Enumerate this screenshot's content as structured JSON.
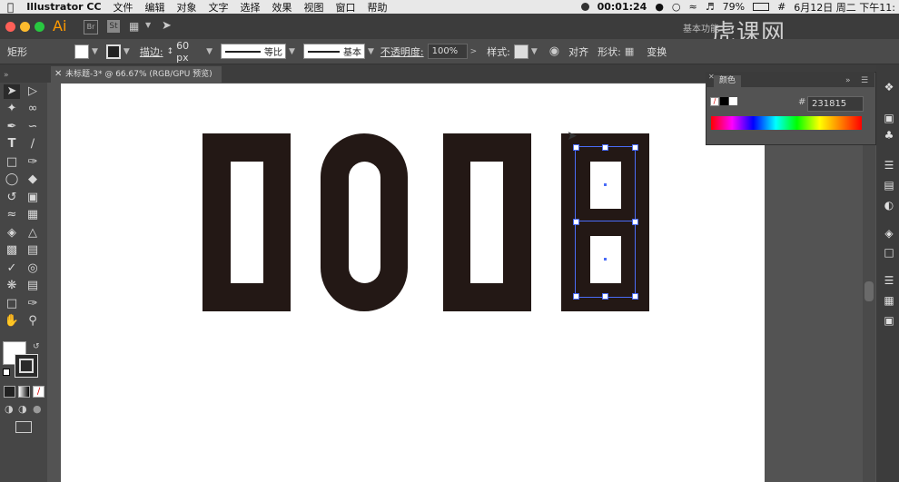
{
  "menubar": {
    "app_name": "Illustrator CC",
    "items": [
      "文件",
      "编辑",
      "对象",
      "文字",
      "选择",
      "效果",
      "视图",
      "窗口",
      "帮助"
    ],
    "timer": "00:01:24",
    "battery": "79%",
    "datetime": "6月12日 周二 下午11:"
  },
  "appbar": {
    "ai_logo": "Ai",
    "st_logo": "St",
    "workspace": "基本功能",
    "watermark": "虎课网"
  },
  "control_bar": {
    "tool_name": "矩形",
    "stroke_label": "描边:",
    "stroke_value": "60 px",
    "profile_label": "等比",
    "brush_label": "基本",
    "opacity_label": "不透明度:",
    "opacity_value": "100%",
    "style_label": "样式:",
    "align_label": "对齐",
    "shape_label": "形状:",
    "transform_label": "变换"
  },
  "document_tab": {
    "title": "未标题-3* @ 66.67% (RGB/GPU 预览)"
  },
  "color_panel": {
    "title": "颜色",
    "hex_label": "#",
    "hex_value": "231815"
  },
  "colors": {
    "fill": "#231815",
    "selection": "#4a6cf7",
    "canvas": "#ffffff",
    "ui_dark": "#535353"
  },
  "icons": [
    "apple-icon",
    "close-icon",
    "chevron-down-icon",
    "selection-tool-icon",
    "direct-selection-icon",
    "magic-wand-icon",
    "lasso-icon",
    "pen-icon",
    "type-tool-icon",
    "line-tool-icon",
    "rectangle-tool-icon",
    "brush-icon",
    "eraser-icon",
    "rotate-icon",
    "scale-icon",
    "graph-icon",
    "eyedropper-icon",
    "hand-icon",
    "zoom-icon",
    "fill-swatch-icon",
    "stroke-swatch-icon"
  ]
}
